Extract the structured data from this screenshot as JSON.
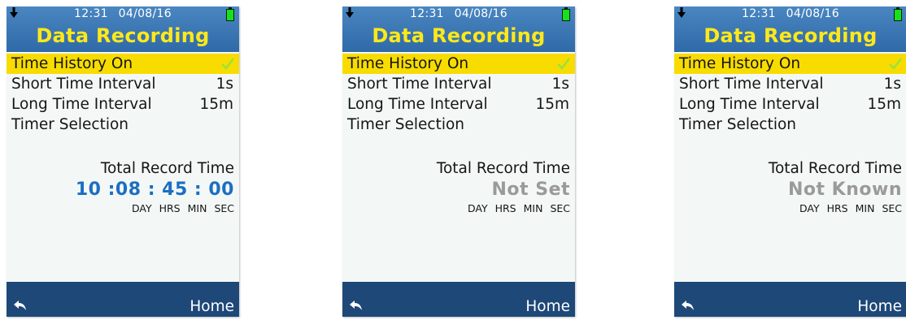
{
  "screens": [
    {
      "status": {
        "time": "12:31",
        "date": "04/08/16"
      },
      "title": "Data Recording",
      "menu": [
        {
          "label": "Time History On",
          "value": "",
          "selected": true,
          "checked": true
        },
        {
          "label": "Short Time Interval",
          "value": "1s"
        },
        {
          "label": "Long Time Interval",
          "value": "15m"
        },
        {
          "label": "Timer Selection",
          "value": ""
        }
      ],
      "record": {
        "title": "Total Record Time",
        "value": "10 :08 : 45 : 00",
        "units": [
          "DAY",
          "HRS",
          "MIN",
          "SEC"
        ]
      },
      "footer": {
        "home": "Home"
      }
    },
    {
      "status": {
        "time": "12:31",
        "date": "04/08/16"
      },
      "title": "Data Recording",
      "menu": [
        {
          "label": "Time History On",
          "value": "",
          "selected": true,
          "checked": true
        },
        {
          "label": "Short Time Interval",
          "value": "1s"
        },
        {
          "label": "Long Time Interval",
          "value": "15m"
        },
        {
          "label": "Timer Selection",
          "value": ""
        }
      ],
      "record": {
        "title": "Total Record Time",
        "value": "Not Set",
        "units": [
          "DAY",
          "HRS",
          "MIN",
          "SEC"
        ]
      },
      "footer": {
        "home": "Home"
      }
    },
    {
      "status": {
        "time": "12:31",
        "date": "04/08/16"
      },
      "title": "Data Recording",
      "menu": [
        {
          "label": "Time History On",
          "value": "",
          "selected": true,
          "checked": true
        },
        {
          "label": "Short Time Interval",
          "value": "1s"
        },
        {
          "label": "Long Time Interval",
          "value": "15m"
        },
        {
          "label": "Timer Selection",
          "value": ""
        }
      ],
      "record": {
        "title": "Total Record Time",
        "value": "Not Known",
        "units": [
          "DAY",
          "HRS",
          "MIN",
          "SEC"
        ]
      },
      "footer": {
        "home": "Home"
      }
    }
  ],
  "colors": {
    "header": "#3d7ab8",
    "title": "#ffe81a",
    "selected_row": "#f8dc00",
    "checkmark": "#9be33a",
    "record_value_set": "#1b6fc1",
    "record_value_unset": "#9a9a9a",
    "footer": "#1e4878",
    "battery": "#14e21a"
  },
  "icons": [
    "download-icon",
    "battery-icon",
    "check-icon",
    "back-arrow-icon"
  ]
}
